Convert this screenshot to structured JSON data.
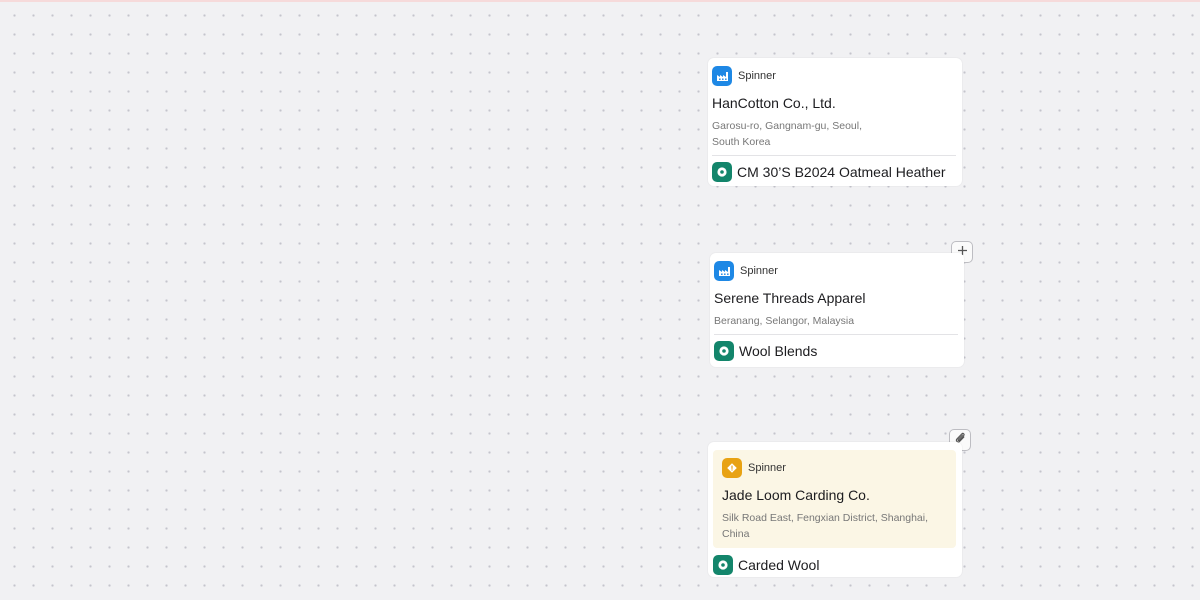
{
  "colors": {
    "canvas": "#f1f1f3",
    "card": "#ffffff",
    "spinner_badge_blue": "#1e88e5",
    "spinner_badge_amber": "#e8a213",
    "product_icon": "#13856b",
    "highlight_bg": "#fbf6e5"
  },
  "cards": [
    {
      "type_label": "Spinner",
      "type_icon": "factory-icon",
      "title": "HanCotton Co., Ltd.",
      "address_line1": "Garosu-ro, Gangnam-gu, Seoul,",
      "address_line2": "South Korea",
      "product_icon": "yarn-cone-icon",
      "product": "CM 30’S B2024 Oatmeal Heather"
    },
    {
      "type_label": "Spinner",
      "type_icon": "factory-icon",
      "title": "Serene Threads Apparel",
      "address_line1": "Beranang, Selangor, Malaysia",
      "product_icon": "yarn-cone-icon",
      "product": "Wool Blends"
    },
    {
      "type_label": "Spinner",
      "type_icon": "warning-icon",
      "title": "Jade Loom Carding Co.",
      "address_line1": "Silk Road East, Fengxian District, Shanghai,",
      "address_line2": "China",
      "product_icon": "yarn-cone-icon",
      "product": "Carded Wool"
    }
  ],
  "controls": {
    "add_icon": "plus-icon",
    "attach_icon": "paperclip-icon"
  }
}
